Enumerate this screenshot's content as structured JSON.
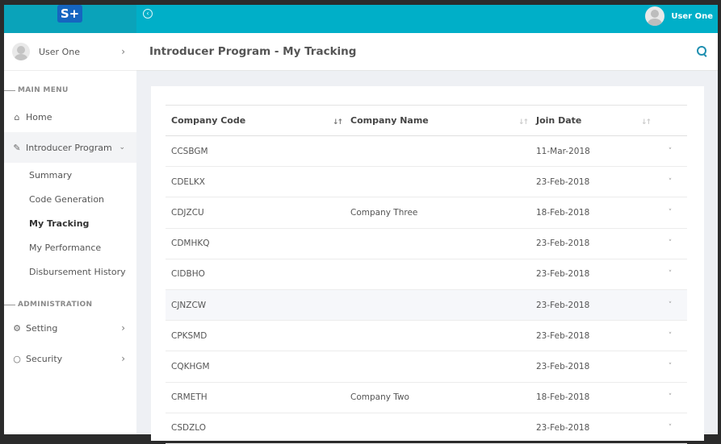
{
  "app": {
    "logo_text": "S+",
    "collapse_icon": "collapse-circle-icon"
  },
  "topbar": {
    "user_name": "User One"
  },
  "sidebar": {
    "user_name": "User One",
    "main_menu_title": "MAIN MENU",
    "home_label": "Home",
    "introducer_label": "Introducer Program",
    "sub_items": [
      "Summary",
      "Code Generation",
      "My Tracking",
      "My Performance",
      "Disbursement History"
    ],
    "selected_sub": "My Tracking",
    "admin_title": "ADMINISTRATION",
    "setting_label": "Setting",
    "security_label": "Security"
  },
  "header": {
    "title": "Introducer Program - My Tracking"
  },
  "table": {
    "columns": [
      "Company Code",
      "Company Name",
      "Join Date"
    ],
    "rows": [
      {
        "code": "CCSBGM",
        "name": "",
        "date": "11-Mar-2018"
      },
      {
        "code": "CDELKX",
        "name": "",
        "date": "23-Feb-2018"
      },
      {
        "code": "CDJZCU",
        "name": "Company Three",
        "date": "18-Feb-2018"
      },
      {
        "code": "CDMHKQ",
        "name": "",
        "date": "23-Feb-2018"
      },
      {
        "code": "CIDBHO",
        "name": "",
        "date": "23-Feb-2018"
      },
      {
        "code": "CJNZCW",
        "name": "",
        "date": "23-Feb-2018"
      },
      {
        "code": "CPKSMD",
        "name": "",
        "date": "23-Feb-2018"
      },
      {
        "code": "CQKHGM",
        "name": "",
        "date": "23-Feb-2018"
      },
      {
        "code": "CRMETH",
        "name": "Company Two",
        "date": "18-Feb-2018"
      },
      {
        "code": "CSDZLO",
        "name": "",
        "date": "23-Feb-2018"
      }
    ]
  },
  "colors": {
    "topbar": "#00afc8",
    "logo": "#1565c0",
    "accent": "#1f8fb0"
  }
}
